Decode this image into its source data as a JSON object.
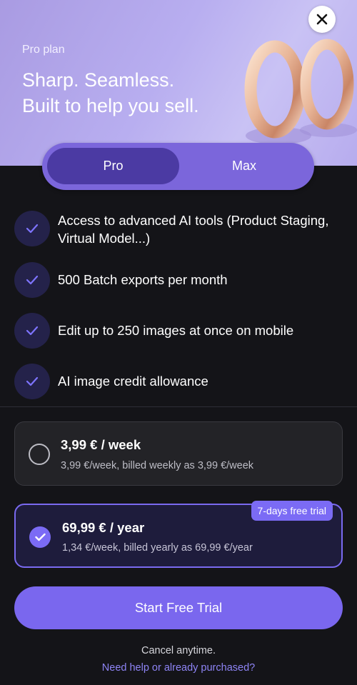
{
  "hero": {
    "eyebrow": "Pro plan",
    "title_line1": "Sharp. Seamless.",
    "title_line2": "Built to help you sell."
  },
  "close_icon": "close-icon",
  "tabs": [
    {
      "label": "Pro",
      "selected": true
    },
    {
      "label": "Max",
      "selected": false
    }
  ],
  "features": [
    {
      "icon": "checkmark-icon",
      "text": "Access to advanced AI tools (Product Staging, Virtual Model...)"
    },
    {
      "icon": "checkmark-icon",
      "text": "500 Batch exports per month"
    },
    {
      "icon": "checkmark-icon",
      "text": "Edit up to 250 images at once on mobile"
    },
    {
      "icon": "checkmark-icon",
      "text": "AI image credit allowance"
    }
  ],
  "plans": [
    {
      "price": "3,99 € / week",
      "detail": "3,99 €/week, billed weekly as 3,99 €/week",
      "selected": false
    },
    {
      "price": "69,99 € / year",
      "detail": "1,34 €/week, billed yearly as 69,99 €/year",
      "selected": true,
      "badge": "7-days free trial"
    }
  ],
  "cta_label": "Start Free Trial",
  "cancel_text": "Cancel anytime.",
  "help_link": "Need help or already purchased?",
  "colors": {
    "accent": "#7a67ee",
    "background": "#141418",
    "selected_tab": "#4b3aa3",
    "link": "#8e84f5"
  }
}
